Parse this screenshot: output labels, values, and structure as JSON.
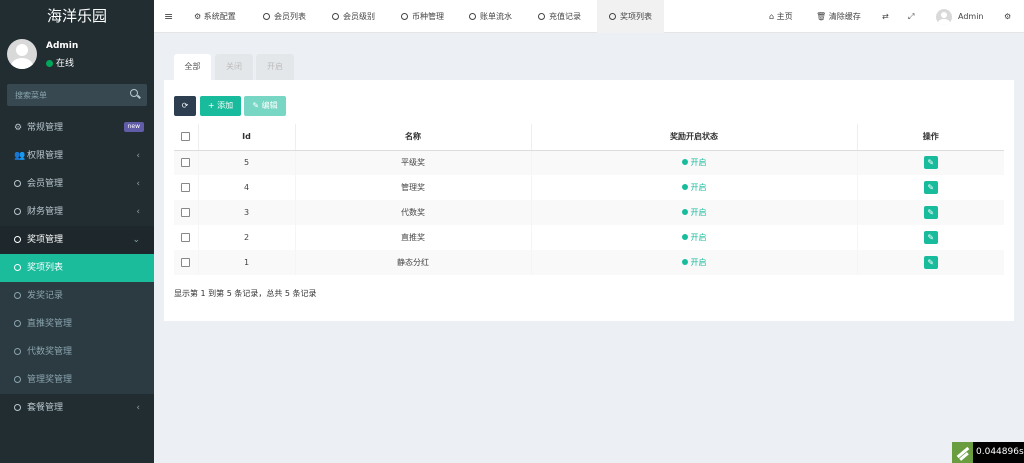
{
  "sidebar": {
    "logo": "海洋乐园",
    "user_name": "Admin",
    "user_status": "在线",
    "search_placeholder": "搜索菜单",
    "menu": [
      {
        "label": "常规管理",
        "icon": "cogs-icon",
        "badge": "new"
      },
      {
        "label": "权限管理",
        "icon": "users-icon"
      },
      {
        "label": "会员管理",
        "icon": "circle-icon"
      },
      {
        "label": "财务管理",
        "icon": "circle-icon"
      },
      {
        "label": "奖项管理",
        "icon": "circle-icon"
      }
    ],
    "submenu": [
      {
        "label": "奖项列表",
        "active": true
      },
      {
        "label": "发奖记录"
      },
      {
        "label": "直推奖管理"
      },
      {
        "label": "代数奖管理"
      },
      {
        "label": "管理奖管理"
      }
    ],
    "last_menu": {
      "label": "套餐管理",
      "icon": "circle-icon"
    }
  },
  "topbar": {
    "tabs": [
      {
        "label": "系统配置",
        "icon": "gear-icon"
      },
      {
        "label": "会员列表",
        "icon": "circle-icon"
      },
      {
        "label": "会员级别",
        "icon": "circle-icon"
      },
      {
        "label": "币种管理",
        "icon": "circle-icon"
      },
      {
        "label": "账单流水",
        "icon": "circle-icon"
      },
      {
        "label": "充值记录",
        "icon": "circle-icon"
      },
      {
        "label": "奖项列表",
        "icon": "circle-icon",
        "active": true
      }
    ],
    "home": "主页",
    "clear_cache": "清除缓存",
    "user": "Admin"
  },
  "filter_tabs": [
    "全部",
    "关闭",
    "开启"
  ],
  "toolbar": {
    "add": "添加",
    "edit": "编辑"
  },
  "table": {
    "headers": [
      "Id",
      "名称",
      "奖励开启状态",
      "操作"
    ],
    "rows": [
      {
        "id": "5",
        "name": "平级奖",
        "status": "开启"
      },
      {
        "id": "4",
        "name": "管理奖",
        "status": "开启"
      },
      {
        "id": "3",
        "name": "代数奖",
        "status": "开启"
      },
      {
        "id": "2",
        "name": "直推奖",
        "status": "开启"
      },
      {
        "id": "1",
        "name": "静态分红",
        "status": "开启"
      }
    ]
  },
  "footer_text": "显示第 1 到第 5 条记录，总共 5 条记录",
  "timer": "0.044896s",
  "colors": {
    "accent": "#18bc9c",
    "sidebar": "#222d32",
    "dark_button": "#2c3e50"
  }
}
